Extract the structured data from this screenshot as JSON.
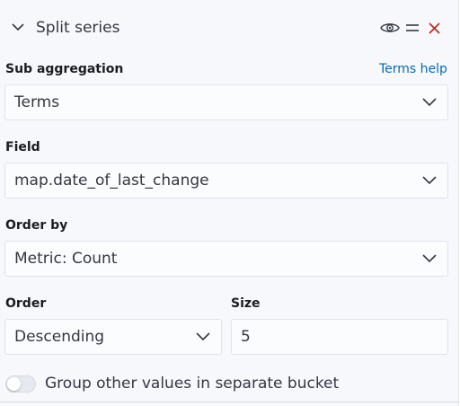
{
  "header": {
    "title": "Split series",
    "icons": {
      "collapse": "chevron-down-icon",
      "visibility": "eye-icon",
      "drag": "drag-handle-icon",
      "remove": "close-icon"
    },
    "remove_color": "#bd271e"
  },
  "sub_aggregation": {
    "label": "Sub aggregation",
    "help_link": "Terms help",
    "value": "Terms"
  },
  "field": {
    "label": "Field",
    "value": "map.date_of_last_change"
  },
  "order_by": {
    "label": "Order by",
    "value": "Metric: Count"
  },
  "order": {
    "label": "Order",
    "value": "Descending"
  },
  "size": {
    "label": "Size",
    "value": "5"
  },
  "other_bucket": {
    "label": "Group other values in separate bucket",
    "enabled": false
  },
  "colors": {
    "link": "#006bb8",
    "text": "#343741",
    "label": "#1a1c21"
  }
}
